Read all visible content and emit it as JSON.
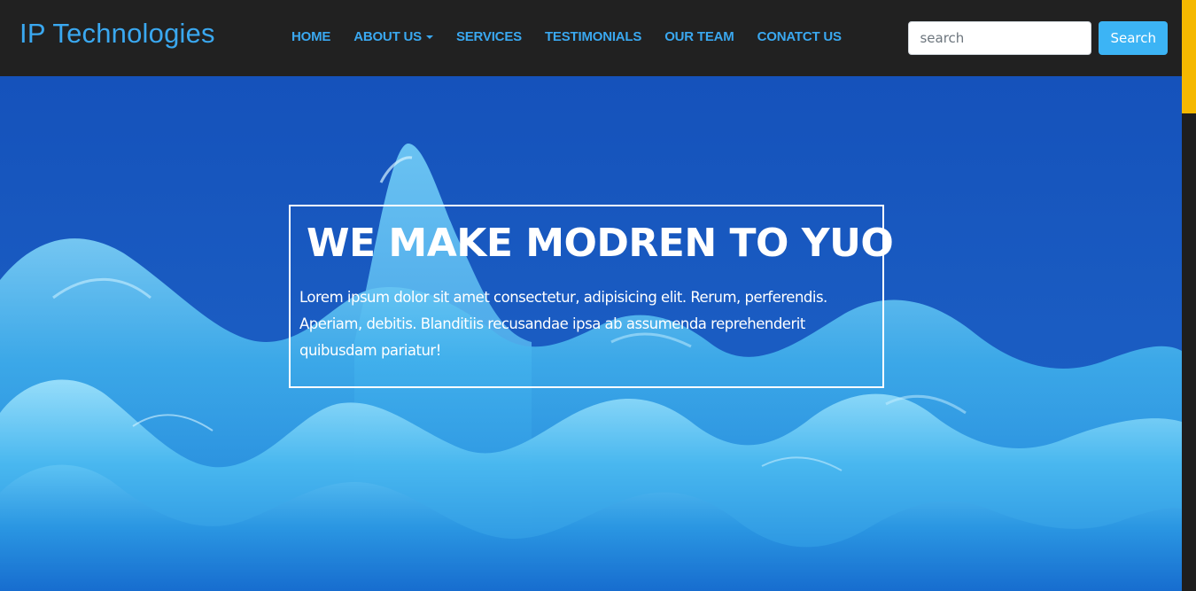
{
  "navbar": {
    "brand": "IP Technologies",
    "links": [
      {
        "label": "HOME"
      },
      {
        "label": "ABOUT US"
      },
      {
        "label": "SERVICES"
      },
      {
        "label": "TESTIMONIALS"
      },
      {
        "label": "OUR TEAM"
      },
      {
        "label": "CONATCT US"
      }
    ],
    "search": {
      "placeholder": "search",
      "button_label": "Search"
    }
  },
  "hero": {
    "title": "WE MAKE MODREN TO YUO",
    "text": "Lorem ipsum dolor sit amet consectetur, adipisicing elit. Rerum, perferendis. Aperiam, debitis. Blanditiis recusandae ipsa ab assumenda reprehenderit quibusdam pariatur!"
  },
  "colors": {
    "navbar_bg": "#212121",
    "accent": "#3aa8f0",
    "search_button": "#3cb4f5",
    "hero_bg": "#1558c0",
    "scrollbar_thumb": "#f5b800"
  }
}
